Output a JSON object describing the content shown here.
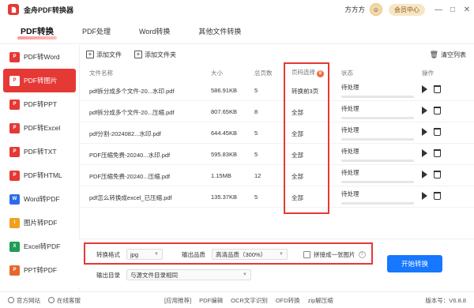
{
  "titlebar": {
    "app_title": "金舟PDF转换器",
    "username": "方方方",
    "vip_label": "会员中心",
    "minimize": "—",
    "maximize": "□",
    "close": "✕"
  },
  "top_tabs": [
    "PDF转换",
    "PDF处理",
    "Word转换",
    "其他文件转换"
  ],
  "sidebar": {
    "items": [
      {
        "label": "PDF转Word",
        "color": "#e53935"
      },
      {
        "label": "PDF转图片",
        "color": "#e53935"
      },
      {
        "label": "PDF转PPT",
        "color": "#e53935"
      },
      {
        "label": "PDF转Excel",
        "color": "#e53935"
      },
      {
        "label": "PDF转TXT",
        "color": "#e53935"
      },
      {
        "label": "PDF转HTML",
        "color": "#e53935"
      },
      {
        "label": "Word转PDF",
        "color": "#2b6de8"
      },
      {
        "label": "图片转PDF",
        "color": "#f0a020"
      },
      {
        "label": "Excel转PDF",
        "color": "#1f9d55"
      },
      {
        "label": "PPT转PDF",
        "color": "#e8662b"
      }
    ]
  },
  "toolbar": {
    "add_file": "添加文件",
    "add_folder": "添加文件夹",
    "clear_list": "清空列表"
  },
  "table": {
    "headers": {
      "name": "文件名称",
      "size": "大小",
      "pages": "总页数",
      "range": "页码选择",
      "status": "状态",
      "ops": "操作"
    },
    "rows": [
      {
        "name": "pdf拆分成多个文件-20...水印.pdf",
        "size": "586.91KB",
        "pages": "5",
        "range": "转换前3页",
        "status": "待处理"
      },
      {
        "name": "pdf拆分成多个文件-20...压缩.pdf",
        "size": "807.65KB",
        "pages": "8",
        "range": "全部",
        "status": "待处理"
      },
      {
        "name": "pdf分割-2024082...水印.pdf",
        "size": "644.45KB",
        "pages": "5",
        "range": "全部",
        "status": "待处理"
      },
      {
        "name": "PDF压缩免费-20240...水印.pdf",
        "size": "595.83KB",
        "pages": "5",
        "range": "全部",
        "status": "待处理"
      },
      {
        "name": "PDF压缩免费-20240...压缩.pdf",
        "size": "1.15MB",
        "pages": "12",
        "range": "全部",
        "status": "待处理"
      },
      {
        "name": "pdf怎么转换成excel_已压缩.pdf",
        "size": "135.37KB",
        "pages": "5",
        "range": "全部",
        "status": "待处理"
      }
    ]
  },
  "settings": {
    "format_label": "转换格式",
    "format_value": "jpg",
    "quality_label": "输出品质",
    "quality_value": "高清品质（300%）",
    "merge_label": "拼接成一张图片",
    "output_label": "输出目录",
    "output_value": "与源文件目录相同",
    "start_button": "开始转换"
  },
  "statusbar": {
    "website": "官方网站",
    "service": "在线客服",
    "links": [
      "[应用推荐]",
      "PDF编辑",
      "OCR文字识别",
      "OFD转换",
      "zip解压缩"
    ],
    "version": "版本号：V6.8.8"
  }
}
